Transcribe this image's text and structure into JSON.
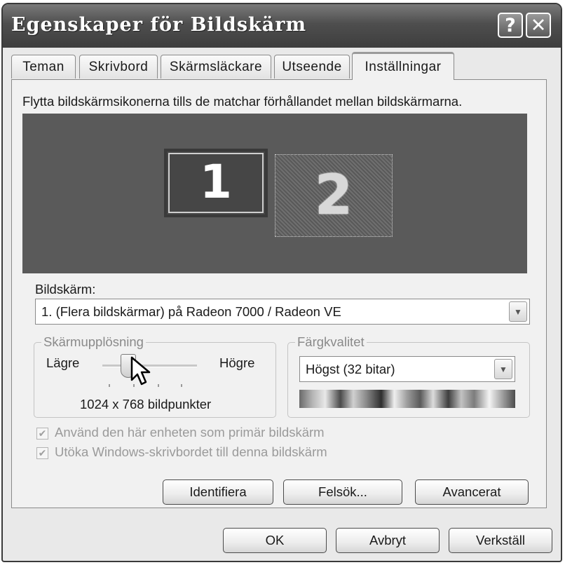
{
  "window": {
    "title": "Egenskaper för Bildskärm"
  },
  "titlebar_buttons": {
    "help_label": "?",
    "close_label": "✕"
  },
  "tabs": [
    {
      "label": "Teman"
    },
    {
      "label": "Skrivbord"
    },
    {
      "label": "Skärmsläckare"
    },
    {
      "label": "Utseende"
    },
    {
      "label": "Inställningar",
      "active": true
    }
  ],
  "settings": {
    "instruction": "Flytta bildskärmsikonerna tills de matchar förhållandet mellan bildskärmarna.",
    "monitors": [
      {
        "number": "1",
        "primary": true
      },
      {
        "number": "2",
        "primary": false
      }
    ],
    "display_label": "Bildskärm:",
    "display_value": "1. (Flera bildskärmar) på Radeon 7000 / Radeon VE",
    "resolution": {
      "legend": "Skärmupplösning",
      "low_label": "Lägre",
      "high_label": "Högre",
      "value_text": "1024 x 768 bildpunkter",
      "slider_position": 0.3
    },
    "color_quality": {
      "legend": "Färgkvalitet",
      "value": "Högst (32 bitar)"
    },
    "checkbox_primary": {
      "label": "Använd den här enheten som primär bildskärm",
      "checked": true,
      "enabled": false
    },
    "checkbox_extend": {
      "label": "Utöka Windows-skrivbordet till denna bildskärm",
      "checked": true,
      "enabled": false
    },
    "buttons": {
      "identify": "Identifiera",
      "troubleshoot": "Felsök...",
      "advanced": "Avancerat"
    }
  },
  "footer": {
    "ok": "OK",
    "cancel": "Avbryt",
    "apply": "Verkställ"
  },
  "icons": {
    "dropdown_arrow": "chevron-down-icon",
    "checkmark": "check-icon",
    "cursor": "mouse-pointer-icon"
  }
}
